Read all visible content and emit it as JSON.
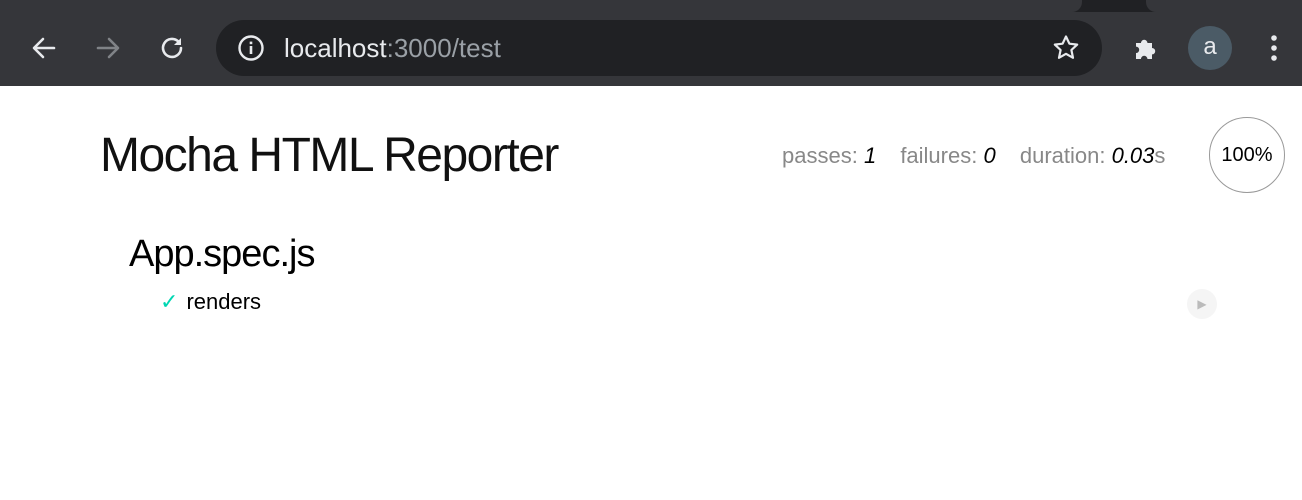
{
  "browser": {
    "url_host": "localhost",
    "url_path": ":3000/test",
    "profile_initial": "a",
    "icons": {
      "back": "arrow-left-icon",
      "forward": "arrow-right-icon",
      "reload": "reload-icon",
      "site_info": "info-icon",
      "bookmark": "star-icon",
      "extensions": "puzzle-piece-icon",
      "menu": "kebab-menu-icon"
    }
  },
  "report": {
    "title": "Mocha HTML Reporter",
    "stats": {
      "passes_label": "passes: ",
      "passes": "1",
      "failures_label": "failures: ",
      "failures": "0",
      "duration_label": "duration: ",
      "duration": "0.03",
      "duration_unit": "s"
    },
    "progress": "100%",
    "suite": {
      "title": "App.spec.js",
      "tests": [
        {
          "status_mark": "✓",
          "name": "renders",
          "state": "passed"
        }
      ]
    },
    "replay_glyph": "▶"
  },
  "colors": {
    "chrome_bg": "#35363a",
    "omnibox_bg": "#202124",
    "pass_check": "#00d6b2"
  }
}
